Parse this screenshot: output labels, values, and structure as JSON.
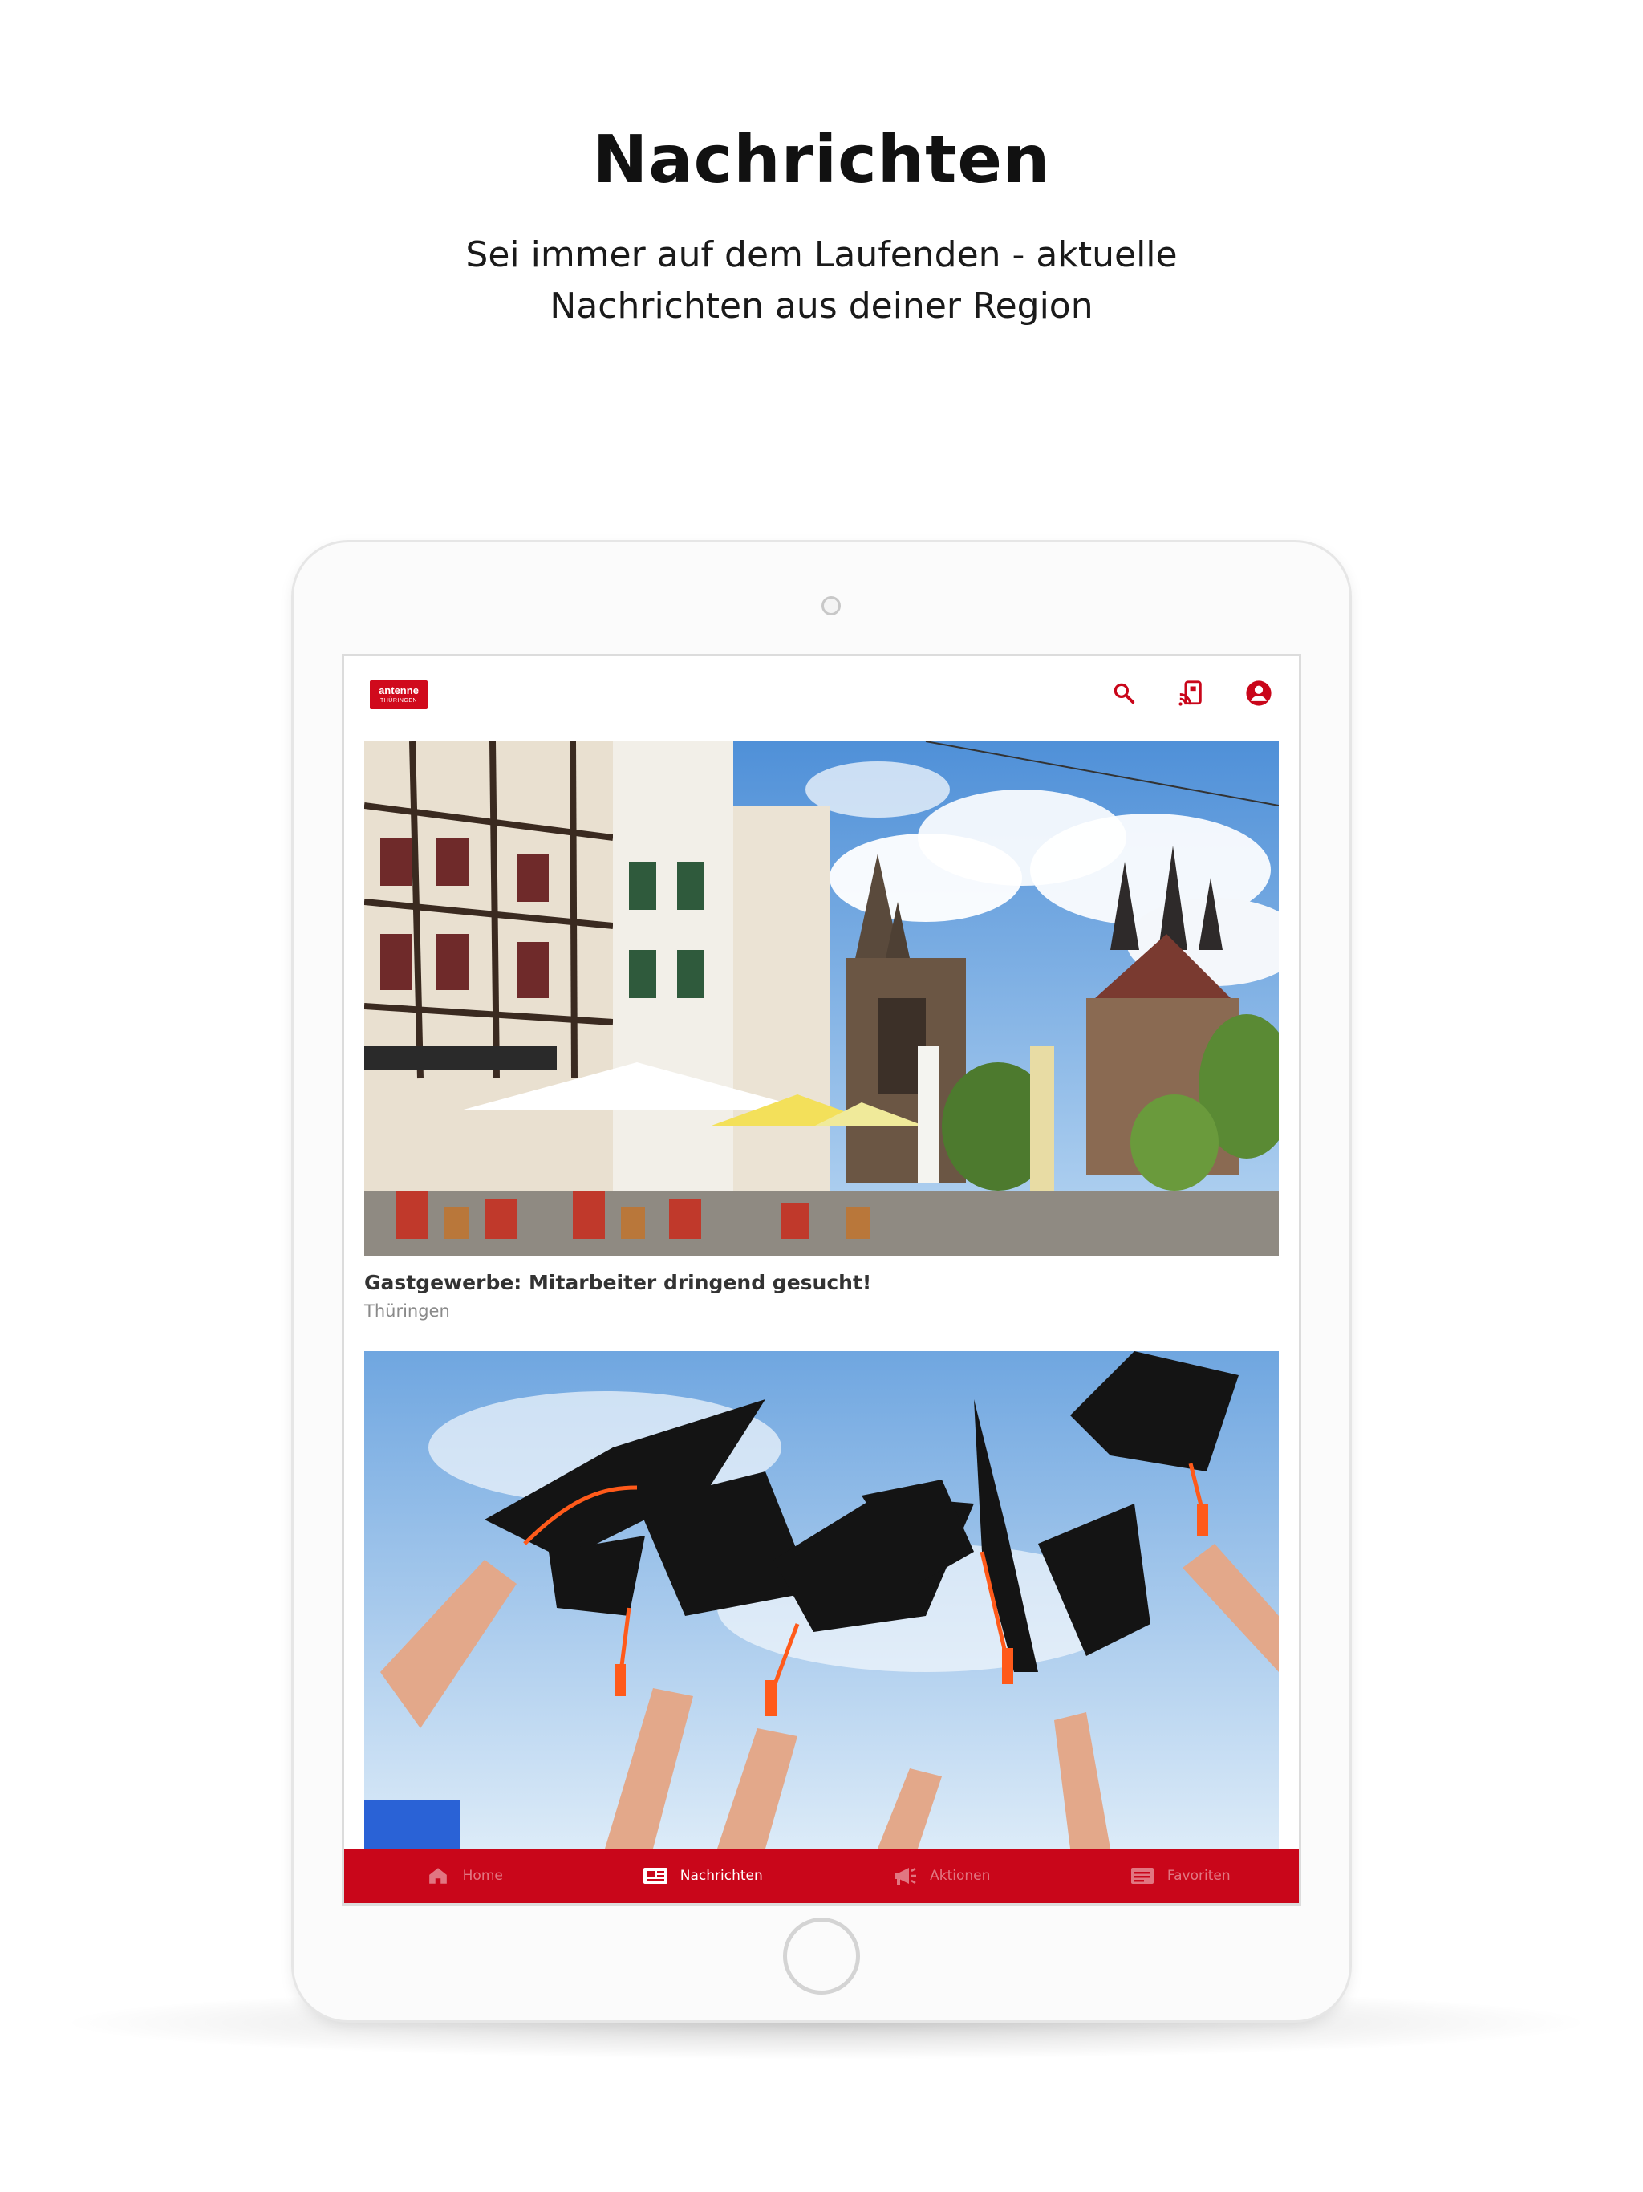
{
  "hero": {
    "title": "Nachrichten",
    "subtitle_line1": "Sei immer auf dem Laufenden - aktuelle",
    "subtitle_line2": "Nachrichten aus deiner Region"
  },
  "app": {
    "logo_top": "antenne",
    "logo_bottom": "THÜRINGEN",
    "brand_color": "#c9061a",
    "icons": [
      "search-icon",
      "cast-icon",
      "account-icon"
    ]
  },
  "news": [
    {
      "title": "Gastgewerbe: Mitarbeiter dringend gesucht!",
      "category": "Thüringen"
    },
    {
      "title": "",
      "category": ""
    }
  ],
  "bottom_nav": [
    {
      "label": "Home",
      "icon": "home-icon",
      "active": false
    },
    {
      "label": "Nachrichten",
      "icon": "newspaper-icon",
      "active": true
    },
    {
      "label": "Aktionen",
      "icon": "megaphone-icon",
      "active": false
    },
    {
      "label": "Favoriten",
      "icon": "favorites-icon",
      "active": false
    }
  ]
}
